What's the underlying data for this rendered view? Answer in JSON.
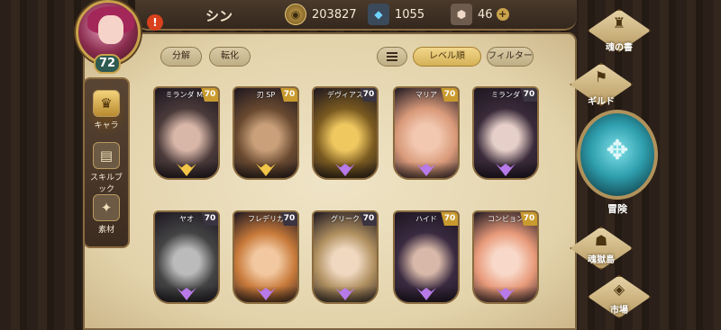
{
  "player": {
    "name": "シン",
    "level": "72",
    "alert": "!"
  },
  "resources": {
    "gold": {
      "icon": "coin-icon",
      "value": "203827"
    },
    "gem": {
      "icon": "crystal-icon",
      "value": "1055"
    },
    "stone": {
      "icon": "stone-icon",
      "value": "46",
      "plus": "+"
    }
  },
  "toolbar": {
    "disassemble": "分解",
    "transfer": "転化",
    "sort_order": "レベル順",
    "filter": "フィルター"
  },
  "sidebar": {
    "items": [
      {
        "label": "キャラ",
        "icon": "crown-icon"
      },
      {
        "label": "スキルブック",
        "icon": "book-icon"
      },
      {
        "label": "素材",
        "icon": "material-icon"
      }
    ]
  },
  "right_menu": {
    "soul_book": "魂の書",
    "guild": "ギルド",
    "adventure": "冒険",
    "prison": "魂獄島",
    "market": "市場"
  },
  "characters": [
    {
      "name": "ミランダ MZ",
      "level": "70",
      "tier": "gold",
      "colors": [
        "#4a3a3a",
        "#d9b7a8"
      ]
    },
    {
      "name": "刃 SP",
      "level": "70",
      "tier": "gold",
      "colors": [
        "#6a4a30",
        "#c9a07a"
      ]
    },
    {
      "name": "デヴィアス",
      "level": "70",
      "tier": "purple",
      "colors": [
        "#7a5a20",
        "#f0c860"
      ]
    },
    {
      "name": "マリア",
      "level": "70",
      "tier": "purple",
      "colors": [
        "#d99a7a",
        "#f2c8b0"
      ]
    },
    {
      "name": "ミランダ",
      "level": "70",
      "tier": "purple",
      "colors": [
        "#3a2a3a",
        "#e6cfc8"
      ]
    },
    {
      "name": "ヤオ",
      "level": "70",
      "tier": "purple",
      "colors": [
        "#444",
        "#bbb"
      ]
    },
    {
      "name": "フレデリカ",
      "level": "70",
      "tier": "purple",
      "colors": [
        "#c87a3a",
        "#f2c8a0"
      ]
    },
    {
      "name": "グリーク",
      "level": "70",
      "tier": "purple",
      "colors": [
        "#b09060",
        "#f0d8c0"
      ]
    },
    {
      "name": "ハイド",
      "level": "70",
      "tier": "purple",
      "colors": [
        "#3a2a40",
        "#d8b8a8"
      ]
    },
    {
      "name": "コンビョン",
      "level": "70",
      "tier": "purple",
      "colors": [
        "#e89a7a",
        "#f8d8c8"
      ]
    }
  ],
  "colors": {
    "accent_gold": "#c9a24b",
    "tier_gold": "#f2c548",
    "tier_purple": "#b77ae8",
    "adventure_teal": "#2f9fae"
  }
}
